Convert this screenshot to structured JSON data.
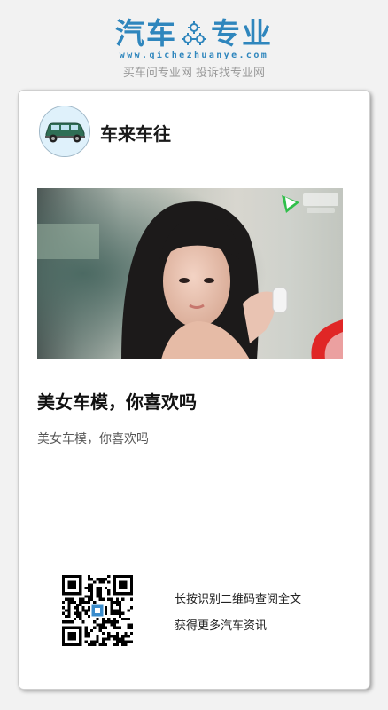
{
  "header": {
    "brand_left": "汽车",
    "brand_right": "专业",
    "website": "www.qichezhuanye.com",
    "slogan": "买车问专业网 投诉找专业网",
    "brand_color": "#2f86bd"
  },
  "card": {
    "author_name": "车来车往",
    "avatar_icon": "car-icon",
    "cover_icon": "play-logo-icon",
    "article_title": "美女车模，你喜欢吗",
    "article_summary": "美女车模，你喜欢吗",
    "qr_line_1": "长按识别二维码查阅全文",
    "qr_line_2": "获得更多汽车资讯"
  }
}
